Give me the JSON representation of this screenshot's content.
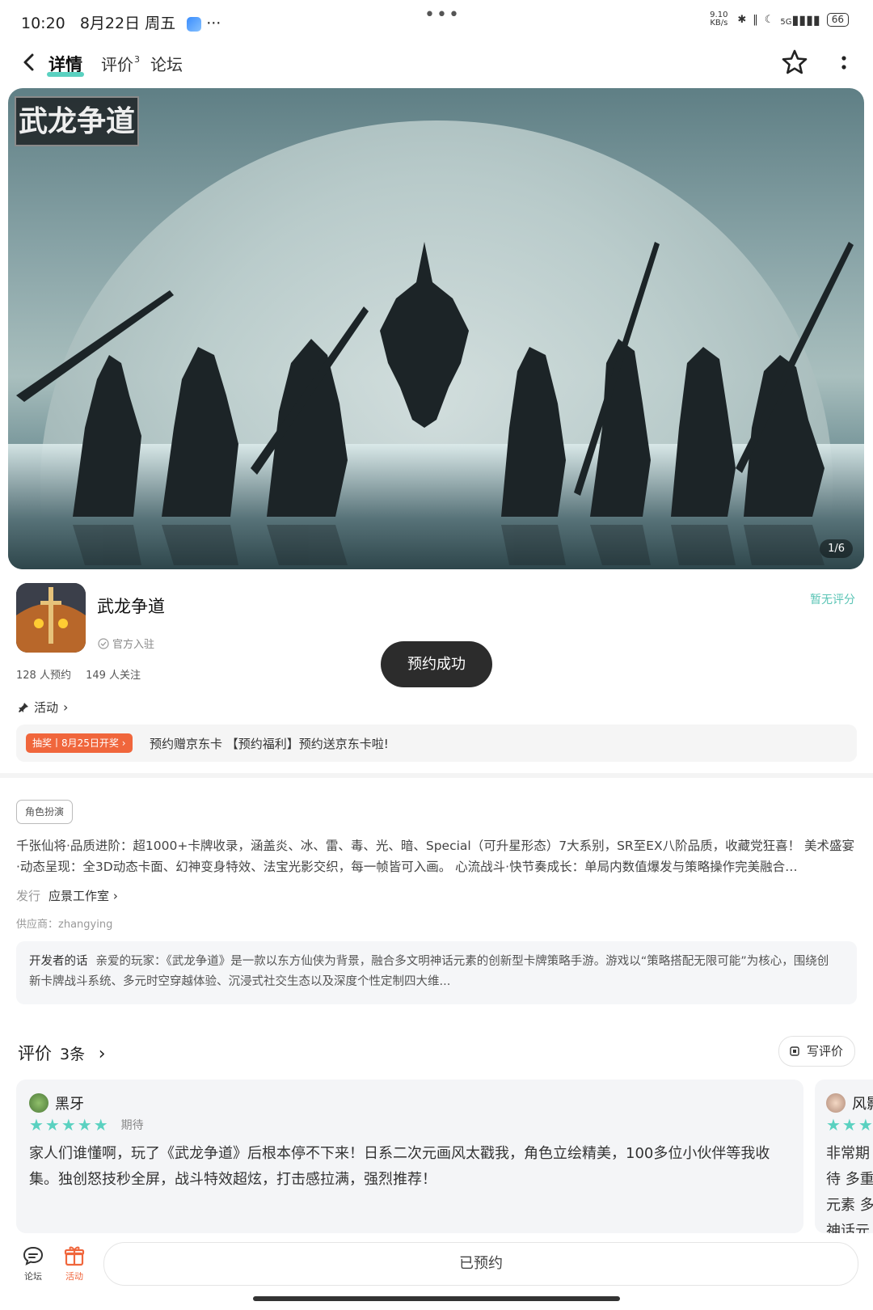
{
  "status_bar": {
    "time": "10:20",
    "date": "8月22日 周五",
    "more": "···",
    "center_dots": "•••",
    "net_speed": "9.10 KB/s",
    "network": "5G",
    "battery": "66"
  },
  "header": {
    "tabs": [
      {
        "label": "详情",
        "active": true
      },
      {
        "label": "评价",
        "badge": "3"
      },
      {
        "label": "论坛"
      }
    ]
  },
  "hero": {
    "logo_text": "武龙争道",
    "page_indicator": "1/6"
  },
  "app": {
    "name": "武龙争道",
    "official": "官方入驻",
    "rating": "暂无评分",
    "reservations": "128 人预约",
    "followers": "149 人关注"
  },
  "toast": "预约成功",
  "activity": {
    "label": "活动",
    "tag": "抽奖丨8月25日开奖",
    "text": "预约赠京东卡 【预约福利】预约送京东卡啦!"
  },
  "details": {
    "genre": "角色扮演",
    "description": "千张仙将·品质进阶：超1000+卡牌收录，涵盖炎、冰、雷、毒、光、暗、Special（可升星形态）7大系别，SR至EX八阶品质，收藏党狂喜！ 美术盛宴·动态呈现：全3D动态卡面、幻神变身特效、法宝光影交织，每一帧皆可入画。 心流战斗·快节奏成长：单局内数值爆发与策略操作完美融合…",
    "publisher_label": "发行",
    "publisher": "应景工作室",
    "supplier": "供应商：zhangying",
    "dev_label": "开发者的话",
    "dev_text": "亲爱的玩家：《武龙争道》是一款以东方仙侠为背景，融合多文明神话元素的创新型卡牌策略手游。游戏以“策略搭配无限可能”为核心，围绕创新卡牌战斗系统、多元时空穿越体验、沉浸式社交生态以及深度个性定制四大维..."
  },
  "reviews": {
    "title": "评价",
    "count": "3条",
    "write": "写评价",
    "items": [
      {
        "user": "黑牙",
        "stars": "★★★★★",
        "tag": "期待",
        "text": "家人们谁懂啊，玩了《武龙争道》后根本停不下来！日系二次元画风太戳我，角色立绘精美，100多位小伙伴等我收集。独创怒技秒全屏，战斗特效超炫，打击感拉满，强烈推荐！"
      },
      {
        "user": "风影",
        "stars": "★★★",
        "text": "非常期待 多重元素 多神话元 战斗自由"
      }
    ]
  },
  "bottom_bar": {
    "forum": "论坛",
    "activity": "活动",
    "reserved": "已预约"
  },
  "colors": {
    "accent": "#5ad1c0",
    "promo": "#f0663c"
  }
}
